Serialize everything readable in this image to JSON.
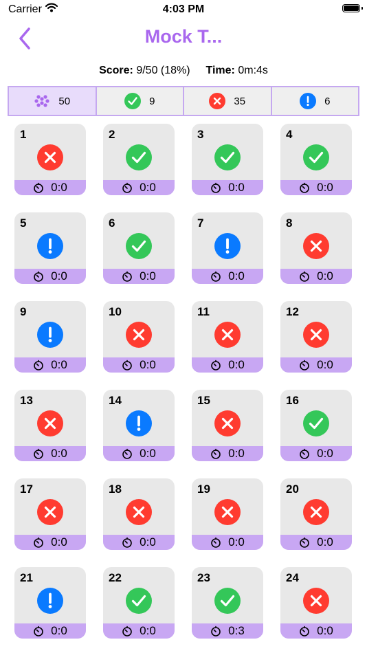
{
  "status_bar": {
    "carrier": "Carrier",
    "time": "4:03 PM"
  },
  "nav": {
    "title": "Mock T..."
  },
  "summary": {
    "score_label": "Score:",
    "score_value": "9/50 (18%)",
    "time_label": "Time:",
    "time_value": "0m:4s"
  },
  "colors": {
    "accent": "#a967ee",
    "correct": "#34c759",
    "wrong": "#ff3b30",
    "skipped": "#0a7aff",
    "footer": "#c8a7f3",
    "card": "#e8e8e8"
  },
  "filters": [
    {
      "icon": "grid-dots-icon",
      "count": "50"
    },
    {
      "icon": "correct-icon",
      "count": "9"
    },
    {
      "icon": "wrong-icon",
      "count": "35"
    },
    {
      "icon": "skipped-icon",
      "count": "6"
    }
  ],
  "questions": [
    {
      "number": "1",
      "status": "wrong",
      "time": "0:0"
    },
    {
      "number": "2",
      "status": "correct",
      "time": "0:0"
    },
    {
      "number": "3",
      "status": "correct",
      "time": "0:0"
    },
    {
      "number": "4",
      "status": "correct",
      "time": "0:0"
    },
    {
      "number": "5",
      "status": "skipped",
      "time": "0:0"
    },
    {
      "number": "6",
      "status": "correct",
      "time": "0:0"
    },
    {
      "number": "7",
      "status": "skipped",
      "time": "0:0"
    },
    {
      "number": "8",
      "status": "wrong",
      "time": "0:0"
    },
    {
      "number": "9",
      "status": "skipped",
      "time": "0:0"
    },
    {
      "number": "10",
      "status": "wrong",
      "time": "0:0"
    },
    {
      "number": "11",
      "status": "wrong",
      "time": "0:0"
    },
    {
      "number": "12",
      "status": "wrong",
      "time": "0:0"
    },
    {
      "number": "13",
      "status": "wrong",
      "time": "0:0"
    },
    {
      "number": "14",
      "status": "skipped",
      "time": "0:0"
    },
    {
      "number": "15",
      "status": "wrong",
      "time": "0:0"
    },
    {
      "number": "16",
      "status": "correct",
      "time": "0:0"
    },
    {
      "number": "17",
      "status": "wrong",
      "time": "0:0"
    },
    {
      "number": "18",
      "status": "wrong",
      "time": "0:0"
    },
    {
      "number": "19",
      "status": "wrong",
      "time": "0:0"
    },
    {
      "number": "20",
      "status": "wrong",
      "time": "0:0"
    },
    {
      "number": "21",
      "status": "skipped",
      "time": "0:0"
    },
    {
      "number": "22",
      "status": "correct",
      "time": "0:0"
    },
    {
      "number": "23",
      "status": "correct",
      "time": "0:3"
    },
    {
      "number": "24",
      "status": "wrong",
      "time": "0:0"
    }
  ]
}
